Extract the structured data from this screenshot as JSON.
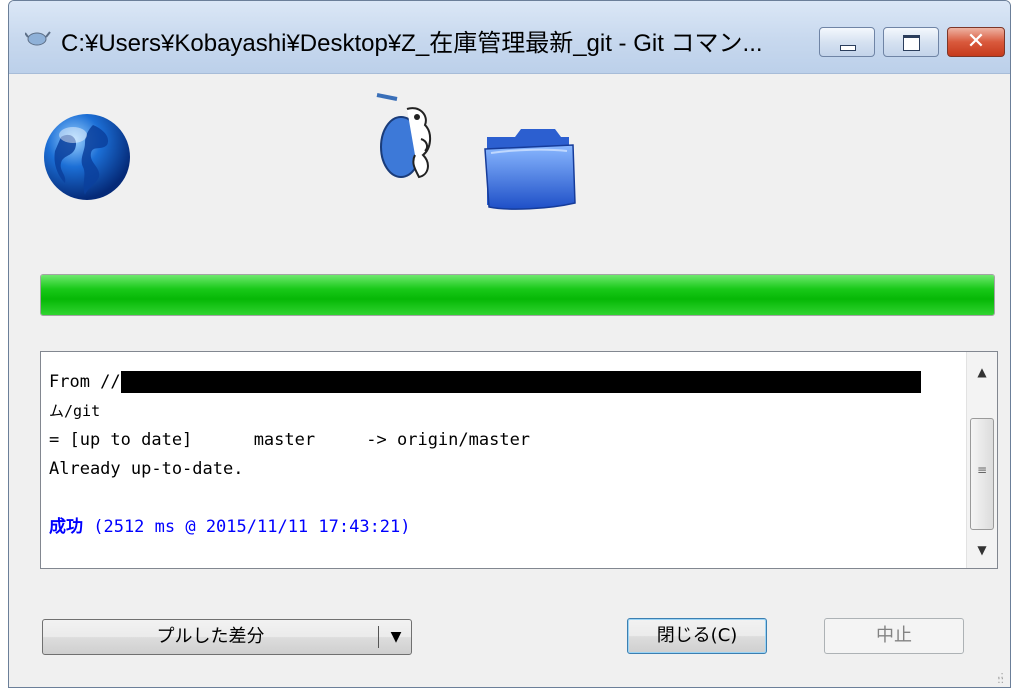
{
  "window": {
    "title": "C:¥Users¥Kobayashi¥Desktop¥Z_在庫管理最新_git - Git コマン...",
    "close_glyph": "✕"
  },
  "progress": {
    "value_percent": 100,
    "color": "#19c919"
  },
  "log": {
    "line1_prefix": "From //",
    "line2": "ム/git",
    "line3": "= [up to date]      master     -> origin/master",
    "line4": "Already up-to-date.",
    "success_word": "成功",
    "success_detail": " (2512 ms @ 2015/11/11 17:43:21)"
  },
  "scrollbar": {
    "up_glyph": "▲",
    "down_glyph": "▼",
    "grip_glyph": "≡"
  },
  "buttons": {
    "pull_diff": "プルした差分",
    "dropdown_glyph": "▼",
    "close": "閉じる(C)",
    "abort": "中止"
  },
  "colors": {
    "success_text": "#0000ff",
    "titlebar": "#c7d8ee",
    "close_button": "#c63a1c"
  }
}
